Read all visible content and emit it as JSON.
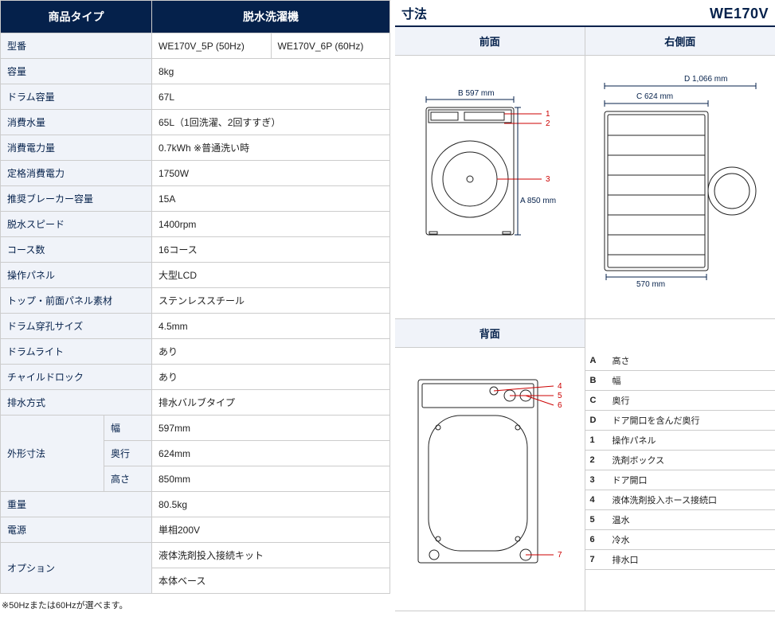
{
  "headers": {
    "type": "商品タイプ",
    "model": "脱水洗濯機"
  },
  "specs": {
    "model_no_label": "型番",
    "model_no_1": "WE170V_5P (50Hz)",
    "model_no_2": "WE170V_6P (60Hz)",
    "capacity_label": "容量",
    "capacity": "8kg",
    "drum_cap_label": "ドラム容量",
    "drum_cap": "67L",
    "water_label": "消費水量",
    "water": "65L（1回洗濯、2回すすぎ）",
    "power_cons_label": "消費電力量",
    "power_cons": "0.7kWh ※普通洗い時",
    "rated_power_label": "定格消費電力",
    "rated_power": "1750W",
    "breaker_label": "推奨ブレーカー容量",
    "breaker": "15A",
    "spin_label": "脱水スピード",
    "spin": "1400rpm",
    "courses_label": "コース数",
    "courses": "16コース",
    "panel_label": "操作パネル",
    "panel": "大型LCD",
    "material_label": "トップ・前面パネル素材",
    "material": "ステンレススチール",
    "perf_label": "ドラム穿孔サイズ",
    "perf": "4.5mm",
    "light_label": "ドラムライト",
    "light": "あり",
    "childlock_label": "チャイルドロック",
    "childlock": "あり",
    "drain_label": "排水方式",
    "drain": "排水バルブタイプ",
    "dims_label": "外形寸法",
    "dims_w_label": "幅",
    "dims_w": "597mm",
    "dims_d_label": "奥行",
    "dims_d": "624mm",
    "dims_h_label": "高さ",
    "dims_h": "850mm",
    "weight_label": "重量",
    "weight": "80.5kg",
    "supply_label": "電源",
    "supply": "単相200V",
    "option_label": "オプション",
    "option_1": "液体洗剤投入接続キット",
    "option_2": "本体ベース"
  },
  "footnote": "※50Hzまたは60Hzが選べます。",
  "dim": {
    "title": "寸法",
    "model": "WE170V",
    "front_label": "前面",
    "right_label": "右側面",
    "back_label": "背面",
    "B_lbl": "B 597 mm",
    "A_lbl": "A 850 mm",
    "C_lbl": "C  624 mm",
    "D_lbl": "D 1,066 mm",
    "base_lbl": "570 mm"
  },
  "legend": {
    "A": {
      "k": "A",
      "v": "高さ"
    },
    "B": {
      "k": "B",
      "v": "幅"
    },
    "C": {
      "k": "C",
      "v": "奥行"
    },
    "D": {
      "k": "D",
      "v": "ドア開口を含んだ奥行"
    },
    "1": {
      "k": "1",
      "v": "操作パネル"
    },
    "2": {
      "k": "2",
      "v": "洗剤ボックス"
    },
    "3": {
      "k": "3",
      "v": "ドア開口"
    },
    "4": {
      "k": "4",
      "v": "液体洗剤投入ホース接続口"
    },
    "5": {
      "k": "5",
      "v": "温水"
    },
    "6": {
      "k": "6",
      "v": "冷水"
    },
    "7": {
      "k": "7",
      "v": "排水口"
    }
  },
  "callouts": {
    "1": "1",
    "2": "2",
    "3": "3",
    "4": "4",
    "5": "5",
    "6": "6",
    "7": "7"
  }
}
